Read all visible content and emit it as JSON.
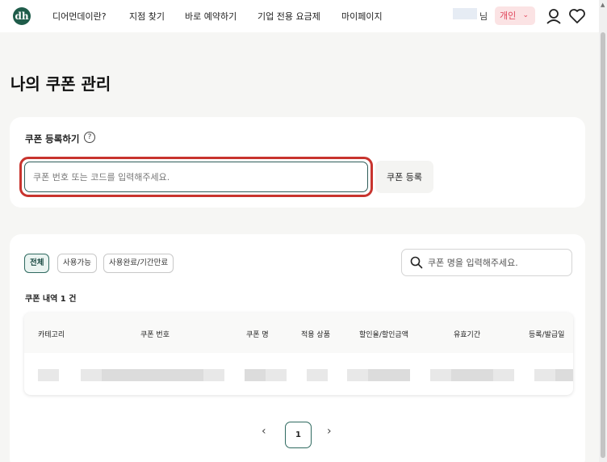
{
  "header": {
    "logo_text": "dh",
    "nav": [
      "디어먼데이란?",
      "지점 찾기",
      "바로 예약하기",
      "기업 전용 요금제",
      "마이페이지"
    ],
    "user_suffix": "님",
    "account_type": "개인",
    "icons": [
      "user-icon",
      "heart-icon"
    ]
  },
  "page": {
    "title": "나의 쿠폰 관리"
  },
  "register": {
    "title": "쿠폰 등록하기",
    "help_symbol": "?",
    "input_placeholder": "쿠폰 번호 또는 코드를 입력해주세요.",
    "button_label": "쿠폰 등록",
    "highlight_color": "#c8342e"
  },
  "coupon_list": {
    "filters": [
      "전체",
      "사용가능",
      "사용완료/기간만료"
    ],
    "active_filter": "전체",
    "search_placeholder": "쿠폰 명을 입력해주세요.",
    "history_count": "쿠폰 내역 1 건",
    "columns": [
      "카테고리",
      "쿠폰 번호",
      "쿠폰 명",
      "적용 상품",
      "할인율/할인금액",
      "유효기간",
      "등록/발급일"
    ]
  },
  "pagination": {
    "prev": "‹",
    "current": "1",
    "next": "›"
  },
  "colors": {
    "accent": "#2f6a60",
    "account_badge_bg": "#fbe3e4",
    "account_badge_text": "#e0455a"
  }
}
